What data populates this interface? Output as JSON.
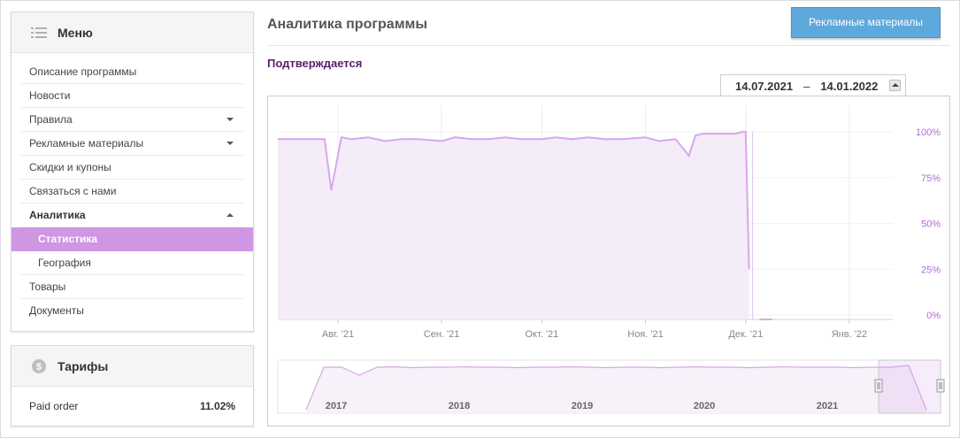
{
  "menu": {
    "title": "Меню",
    "icon": "list-icon",
    "items": [
      {
        "label": "Описание программы"
      },
      {
        "label": "Новости"
      },
      {
        "label": "Правила",
        "caret": "down"
      },
      {
        "label": "Рекламные материалы",
        "caret": "down"
      },
      {
        "label": "Скидки и купоны"
      },
      {
        "label": "Связаться с нами"
      },
      {
        "label": "Аналитика",
        "caret": "up",
        "expanded": true
      },
      {
        "label": "Статистика",
        "sub": true,
        "active": true
      },
      {
        "label": "География",
        "sub": true
      },
      {
        "label": "Товары"
      },
      {
        "label": "Документы"
      }
    ]
  },
  "tariffs": {
    "title": "Тарифы",
    "icon": "coin-icon",
    "rows": [
      {
        "label": "Paid order",
        "value": "11.02%"
      }
    ]
  },
  "main": {
    "title": "Аналитика программы",
    "ad_button": "Рекламные материалы",
    "status": "Подтверждается",
    "date_from": "14.07.2021",
    "date_sep": "–",
    "date_to": "14.01.2022"
  },
  "colors": {
    "accent": "#cf96e3",
    "line": "#d9a6ea",
    "area": "#f4ecf7",
    "button": "#5ea9dc",
    "status": "#5a1d6e",
    "tick_y": "#b66ad3"
  },
  "chart_data": {
    "type": "area",
    "ylim": [
      0,
      100
    ],
    "yticks": [
      "0%",
      "25%",
      "50%",
      "75%",
      "100%"
    ],
    "xticks": [
      "Авг. '21",
      "Сен. '21",
      "Окт. '21",
      "Ноя. '21",
      "Дек. '21",
      "Янв. '22"
    ],
    "series": [
      {
        "x": [
          "2021-07-14",
          "2021-07-20",
          "2021-07-25",
          "2021-07-28",
          "2021-07-30",
          "2021-08-02",
          "2021-08-05",
          "2021-08-10",
          "2021-08-15",
          "2021-08-20",
          "2021-08-25",
          "2021-09-01",
          "2021-09-05",
          "2021-09-10",
          "2021-09-15",
          "2021-09-20",
          "2021-09-25",
          "2021-10-01",
          "2021-10-05",
          "2021-10-10",
          "2021-10-15",
          "2021-10-20",
          "2021-10-25",
          "2021-11-01",
          "2021-11-05",
          "2021-11-10",
          "2021-11-14",
          "2021-11-16",
          "2021-11-18",
          "2021-11-20",
          "2021-11-25",
          "2021-11-28",
          "2021-11-30",
          "2021-12-01",
          "2021-12-02"
        ],
        "y": [
          96,
          96,
          96,
          96,
          68,
          97,
          96,
          97,
          95,
          96,
          96,
          95,
          97,
          96,
          96,
          97,
          96,
          96,
          97,
          96,
          97,
          96,
          96,
          97,
          95,
          96,
          87,
          98,
          99,
          99,
          99,
          99,
          100,
          100,
          25
        ]
      }
    ],
    "navigator": {
      "years": [
        "2017",
        "2018",
        "2019",
        "2020",
        "2021"
      ],
      "series_y": [
        0,
        96,
        96,
        78,
        96,
        97,
        95,
        96,
        96,
        97,
        96,
        96,
        95,
        96,
        96,
        97,
        96,
        95,
        96,
        96,
        95,
        96,
        97,
        96,
        96,
        95,
        96,
        97,
        96,
        96,
        96,
        95,
        96,
        96,
        100,
        0
      ]
    }
  }
}
